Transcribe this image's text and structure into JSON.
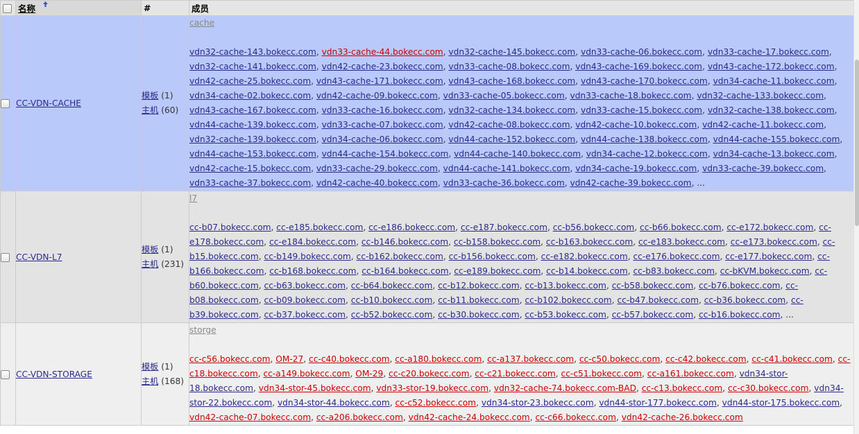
{
  "header": {
    "name_label": "名称",
    "count_label": "#",
    "members_label": "成员"
  },
  "rows": [
    {
      "name": "CC-VDN-CACHE",
      "selected": true,
      "template_label": "模板",
      "template_count": "(1)",
      "host_label": "主机",
      "host_count": "(60)",
      "tag": "cache",
      "members": [
        {
          "text": "vdn32-cache-143.bokecc.com",
          "bad": false
        },
        {
          "text": "vdn33-cache-44.bokecc.com",
          "bad": true
        },
        {
          "text": "vdn32-cache-145.bokecc.com",
          "bad": false
        },
        {
          "text": "vdn33-cache-06.bokecc.com",
          "bad": false
        },
        {
          "text": "vdn33-cache-17.bokecc.com",
          "bad": false
        },
        {
          "text": "vdn32-cache-141.bokecc.com",
          "bad": false
        },
        {
          "text": "vdn42-cache-23.bokecc.com",
          "bad": false
        },
        {
          "text": "vdn33-cache-08.bokecc.com",
          "bad": false
        },
        {
          "text": "vdn43-cache-169.bokecc.com",
          "bad": false
        },
        {
          "text": "vdn43-cache-172.bokecc.com",
          "bad": false
        },
        {
          "text": "vdn42-cache-25.bokecc.com",
          "bad": false
        },
        {
          "text": "vdn43-cache-171.bokecc.com",
          "bad": false
        },
        {
          "text": "vdn43-cache-168.bokecc.com",
          "bad": false
        },
        {
          "text": "vdn43-cache-170.bokecc.com",
          "bad": false
        },
        {
          "text": "vdn34-cache-11.bokecc.com",
          "bad": false
        },
        {
          "text": "vdn34-cache-02.bokecc.com",
          "bad": false
        },
        {
          "text": "vdn42-cache-09.bokecc.com",
          "bad": false
        },
        {
          "text": "vdn33-cache-05.bokecc.com",
          "bad": false
        },
        {
          "text": "vdn33-cache-18.bokecc.com",
          "bad": false
        },
        {
          "text": "vdn32-cache-133.bokecc.com",
          "bad": false
        },
        {
          "text": "vdn43-cache-167.bokecc.com",
          "bad": false
        },
        {
          "text": "vdn33-cache-16.bokecc.com",
          "bad": false
        },
        {
          "text": "vdn32-cache-134.bokecc.com",
          "bad": false
        },
        {
          "text": "vdn33-cache-15.bokecc.com",
          "bad": false
        },
        {
          "text": "vdn32-cache-138.bokecc.com",
          "bad": false
        },
        {
          "text": "vdn44-cache-139.bokecc.com",
          "bad": false
        },
        {
          "text": "vdn33-cache-07.bokecc.com",
          "bad": false
        },
        {
          "text": "vdn42-cache-08.bokecc.com",
          "bad": false
        },
        {
          "text": "vdn42-cache-10.bokecc.com",
          "bad": false
        },
        {
          "text": "vdn42-cache-11.bokecc.com",
          "bad": false
        },
        {
          "text": "vdn32-cache-139.bokecc.com",
          "bad": false
        },
        {
          "text": "vdn34-cache-06.bokecc.com",
          "bad": false
        },
        {
          "text": "vdn44-cache-152.bokecc.com",
          "bad": false
        },
        {
          "text": "vdn44-cache-138.bokecc.com",
          "bad": false
        },
        {
          "text": "vdn44-cache-155.bokecc.com",
          "bad": false
        },
        {
          "text": "vdn44-cache-153.bokecc.com",
          "bad": false
        },
        {
          "text": "vdn44-cache-154.bokecc.com",
          "bad": false
        },
        {
          "text": "vdn44-cache-140.bokecc.com",
          "bad": false
        },
        {
          "text": "vdn34-cache-12.bokecc.com",
          "bad": false
        },
        {
          "text": "vdn34-cache-13.bokecc.com",
          "bad": false
        },
        {
          "text": "vdn42-cache-15.bokecc.com",
          "bad": false
        },
        {
          "text": "vdn33-cache-29.bokecc.com",
          "bad": false
        },
        {
          "text": "vdn44-cache-141.bokecc.com",
          "bad": false
        },
        {
          "text": "vdn34-cache-19.bokecc.com",
          "bad": false
        },
        {
          "text": "vdn33-cache-39.bokecc.com",
          "bad": false
        },
        {
          "text": "vdn33-cache-37.bokecc.com",
          "bad": false
        },
        {
          "text": "vdn42-cache-40.bokecc.com",
          "bad": false
        },
        {
          "text": "vdn33-cache-36.bokecc.com",
          "bad": false
        },
        {
          "text": "vdn42-cache-39.bokecc.com",
          "bad": false
        }
      ],
      "more": "..."
    },
    {
      "name": "CC-VDN-L7",
      "selected": false,
      "template_label": "模板",
      "template_count": "(1)",
      "host_label": "主机",
      "host_count": "(231)",
      "tag": "l7",
      "members": [
        {
          "text": "cc-b07.bokecc.com",
          "bad": false
        },
        {
          "text": "cc-e185.bokecc.com",
          "bad": false
        },
        {
          "text": "cc-e186.bokecc.com",
          "bad": false
        },
        {
          "text": "cc-e187.bokecc.com",
          "bad": false
        },
        {
          "text": "cc-b56.bokecc.com",
          "bad": false
        },
        {
          "text": "cc-b66.bokecc.com",
          "bad": false
        },
        {
          "text": "cc-e172.bokecc.com",
          "bad": false
        },
        {
          "text": "cc-e178.bokecc.com",
          "bad": false
        },
        {
          "text": "cc-e184.bokecc.com",
          "bad": false
        },
        {
          "text": "cc-b146.bokecc.com",
          "bad": false
        },
        {
          "text": "cc-b158.bokecc.com",
          "bad": false
        },
        {
          "text": "cc-b163.bokecc.com",
          "bad": false
        },
        {
          "text": "cc-e183.bokecc.com",
          "bad": false
        },
        {
          "text": "cc-e173.bokecc.com",
          "bad": false
        },
        {
          "text": "cc-b15.bokecc.com",
          "bad": false
        },
        {
          "text": "cc-b149.bokecc.com",
          "bad": false
        },
        {
          "text": "cc-b162.bokecc.com",
          "bad": false
        },
        {
          "text": "cc-b156.bokecc.com",
          "bad": false
        },
        {
          "text": "cc-e182.bokecc.com",
          "bad": false
        },
        {
          "text": "cc-e176.bokecc.com",
          "bad": false
        },
        {
          "text": "cc-e177.bokecc.com",
          "bad": false
        },
        {
          "text": "cc-b166.bokecc.com",
          "bad": false
        },
        {
          "text": "cc-b168.bokecc.com",
          "bad": false
        },
        {
          "text": "cc-b164.bokecc.com",
          "bad": false
        },
        {
          "text": "cc-e189.bokecc.com",
          "bad": false
        },
        {
          "text": "cc-b14.bokecc.com",
          "bad": false
        },
        {
          "text": "cc-b83.bokecc.com",
          "bad": false
        },
        {
          "text": "cc-bKVM.bokecc.com",
          "bad": false
        },
        {
          "text": "cc-b60.bokecc.com",
          "bad": false
        },
        {
          "text": "cc-b63.bokecc.com",
          "bad": false
        },
        {
          "text": "cc-b64.bokecc.com",
          "bad": false
        },
        {
          "text": "cc-b12.bokecc.com",
          "bad": false
        },
        {
          "text": "cc-b13.bokecc.com",
          "bad": false
        },
        {
          "text": "cc-b58.bokecc.com",
          "bad": false
        },
        {
          "text": "cc-b76.bokecc.com",
          "bad": false
        },
        {
          "text": "cc-b08.bokecc.com",
          "bad": false
        },
        {
          "text": "cc-b09.bokecc.com",
          "bad": false
        },
        {
          "text": "cc-b10.bokecc.com",
          "bad": false
        },
        {
          "text": "cc-b11.bokecc.com",
          "bad": false
        },
        {
          "text": "cc-b102.bokecc.com",
          "bad": false
        },
        {
          "text": "cc-b47.bokecc.com",
          "bad": false
        },
        {
          "text": "cc-b36.bokecc.com",
          "bad": false
        },
        {
          "text": "cc-b39.bokecc.com",
          "bad": false
        },
        {
          "text": "cc-b37.bokecc.com",
          "bad": false
        },
        {
          "text": "cc-b52.bokecc.com",
          "bad": false
        },
        {
          "text": "cc-b30.bokecc.com",
          "bad": false
        },
        {
          "text": "cc-b53.bokecc.com",
          "bad": false
        },
        {
          "text": "cc-b57.bokecc.com",
          "bad": false
        },
        {
          "text": "cc-b16.bokecc.com",
          "bad": false
        }
      ],
      "more": "..."
    },
    {
      "name": "CC-VDN-STORAGE",
      "selected": false,
      "template_label": "模板",
      "template_count": "(1)",
      "host_label": "主机",
      "host_count": "(168)",
      "tag": "storge",
      "members": [
        {
          "text": "cc-c56.bokecc.com",
          "bad": true
        },
        {
          "text": "OM-27",
          "bad": true
        },
        {
          "text": "cc-c40.bokecc.com",
          "bad": true
        },
        {
          "text": "cc-a180.bokecc.com",
          "bad": true
        },
        {
          "text": "cc-a137.bokecc.com",
          "bad": true
        },
        {
          "text": "cc-c50.bokecc.com",
          "bad": true
        },
        {
          "text": "cc-c42.bokecc.com",
          "bad": true
        },
        {
          "text": "cc-c41.bokecc.com",
          "bad": true
        },
        {
          "text": "cc-c18.bokecc.com",
          "bad": true
        },
        {
          "text": "cc-a149.bokecc.com",
          "bad": true
        },
        {
          "text": "OM-29",
          "bad": true
        },
        {
          "text": "cc-c20.bokecc.com",
          "bad": true
        },
        {
          "text": "cc-c21.bokecc.com",
          "bad": true
        },
        {
          "text": "cc-c51.bokecc.com",
          "bad": true
        },
        {
          "text": "cc-a161.bokecc.com",
          "bad": true
        },
        {
          "text": "vdn34-stor-18.bokecc.com",
          "bad": false
        },
        {
          "text": "vdn34-stor-45.bokecc.com",
          "bad": true
        },
        {
          "text": "vdn33-stor-19.bokecc.com",
          "bad": true
        },
        {
          "text": "vdn32-cache-74.bokecc.com-BAD",
          "bad": true
        },
        {
          "text": "cc-c13.bokecc.com",
          "bad": true
        },
        {
          "text": "cc-c30.bokecc.com",
          "bad": true
        },
        {
          "text": "vdn34-stor-22.bokecc.com",
          "bad": false
        },
        {
          "text": "vdn34-stor-44.bokecc.com",
          "bad": false
        },
        {
          "text": "cc-c52.bokecc.com",
          "bad": true
        },
        {
          "text": "vdn34-stor-23.bokecc.com",
          "bad": false
        },
        {
          "text": "vdn44-stor-177.bokecc.com",
          "bad": false
        },
        {
          "text": "vdn44-stor-175.bokecc.com",
          "bad": false
        },
        {
          "text": "vdn42-cache-07.bokecc.com",
          "bad": true
        },
        {
          "text": "cc-a206.bokecc.com",
          "bad": true
        },
        {
          "text": "vdn42-cache-24.bokecc.com",
          "bad": true
        },
        {
          "text": "cc-c66.bokecc.com",
          "bad": true
        },
        {
          "text": "vdn42-cache-26.bokecc.com",
          "bad": true
        }
      ],
      "more": ""
    }
  ]
}
